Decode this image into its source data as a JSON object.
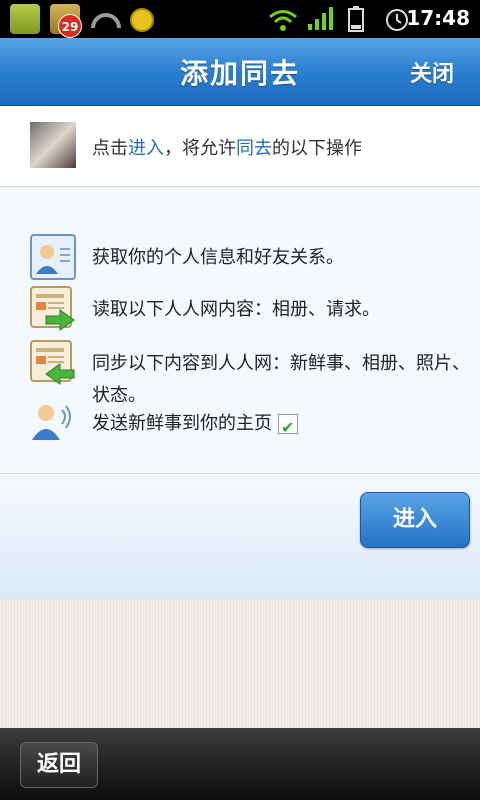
{
  "status_bar": {
    "notification_count": "29",
    "time": "17:48"
  },
  "header": {
    "title": "添加同去",
    "close_label": "关闭"
  },
  "intro": {
    "prefix": "点击",
    "link1": "进入",
    "middle": "，将允许",
    "link2": "同去",
    "suffix": "的以下操作"
  },
  "permissions": [
    {
      "icon": "user-profile-icon",
      "text": "获取你的个人信息和好友关系。"
    },
    {
      "icon": "read-content-icon",
      "text": "读取以下人人网内容：相册、请求。"
    },
    {
      "icon": "sync-content-icon",
      "text": "同步以下内容到人人网：新鲜事、相册、照片、状态。"
    },
    {
      "icon": "broadcast-user-icon",
      "text": "发送新鲜事到你的主页",
      "checked": true
    }
  ],
  "enter_button": "进入",
  "back_button": "返回"
}
